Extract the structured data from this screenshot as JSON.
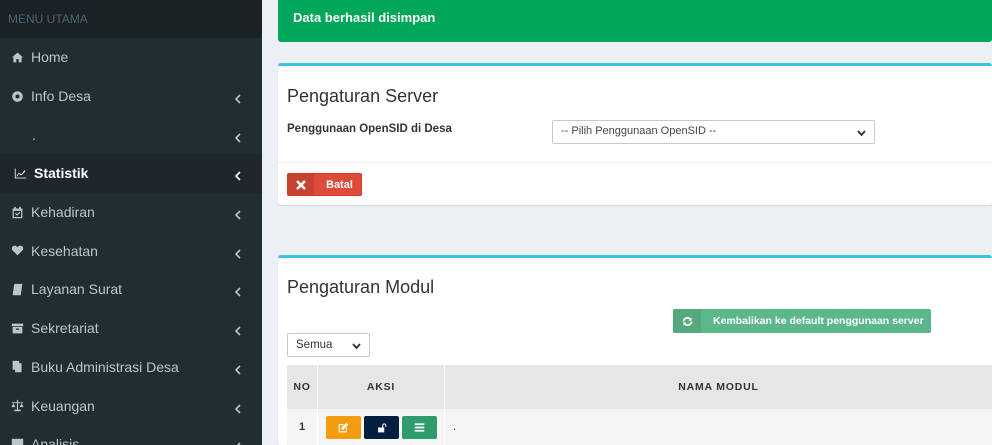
{
  "sidebar": {
    "header": "MENU UTAMA",
    "items": [
      {
        "label": "Home",
        "icon": "home-icon",
        "has_children": false,
        "active": false
      },
      {
        "label": "Info Desa",
        "icon": "info-desa-icon",
        "has_children": true,
        "active": false
      },
      {
        "label": ".",
        "icon": "",
        "has_children": true,
        "active": false
      },
      {
        "label": "Statistik",
        "icon": "chart-icon",
        "has_children": true,
        "active": true
      },
      {
        "label": "Kehadiran",
        "icon": "calendar-check-icon",
        "has_children": true,
        "active": false
      },
      {
        "label": "Kesehatan",
        "icon": "heartbeat-icon",
        "has_children": true,
        "active": false
      },
      {
        "label": "Layanan Surat",
        "icon": "book-icon",
        "has_children": true,
        "active": false
      },
      {
        "label": "Sekretariat",
        "icon": "archive-icon",
        "has_children": true,
        "active": false
      },
      {
        "label": "Buku Administrasi Desa",
        "icon": "file-copy-icon",
        "has_children": true,
        "active": false
      },
      {
        "label": "Keuangan",
        "icon": "balance-scale-icon",
        "has_children": true,
        "active": false
      },
      {
        "label": "Analisis",
        "icon": "check-square-icon",
        "has_children": true,
        "active": false
      }
    ]
  },
  "alert": {
    "text": "Data berhasil disimpan",
    "color": "#00a65a"
  },
  "server_box": {
    "title": "Pengaturan Server",
    "field_label": "Penggunaan OpenSID di Desa",
    "select_value": "-- Pilih Penggunaan OpenSID --",
    "cancel_label": "Batal"
  },
  "modul_box": {
    "title": "Pengaturan Modul",
    "reset_label": "Kembalikan ke default penggunaan server",
    "filter_value": "Semua",
    "columns": [
      "NO",
      "AKSI",
      "NAMA MODUL"
    ],
    "rows": [
      {
        "no": "1",
        "nama": "."
      }
    ]
  },
  "colors": {
    "sidebar_bg": "#222d32",
    "accent": "#3cc1e8",
    "danger": "#dd4b39",
    "success": "#5cb88a",
    "warning": "#f39c12"
  }
}
